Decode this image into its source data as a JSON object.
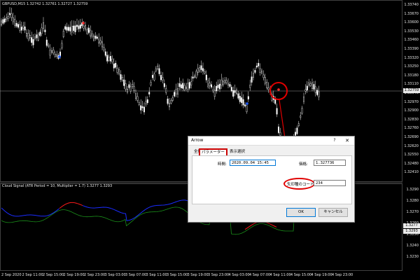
{
  "chart": {
    "title": "GBPUSD,M15  1.32742 1.32761 1.32727 1.32759",
    "current_price": "1.32759",
    "price_labels": [
      "1.33740",
      "1.33670",
      "1.33600",
      "1.33530",
      "1.33460",
      "1.33390",
      "1.33320",
      "1.33250",
      "1.33180",
      "1.33110",
      "1.33040",
      "1.32970",
      "1.32900",
      "1.32830",
      "1.32760",
      "1.32690",
      "1.32620",
      "1.32550",
      "1.32480",
      "1.32410"
    ],
    "time_labels": [
      "2 Sep 2020",
      "2 Sep 11:00",
      "2 Sep 15:00",
      "2 Sep 19:00",
      "2 Sep 23:00",
      "3 Sep 03:00",
      "3 Sep 07:00",
      "3 Sep 11:00",
      "3 Sep 15:00",
      "3 Sep 19:00",
      "3 Sep 23:00",
      "4 Sep 03:00",
      "4 Sep 07:00",
      "4 Sep 11:00",
      "4 Sep 15:00",
      "4 Sep 19:00",
      "4 Sep 23:00"
    ],
    "colors": {
      "background": "#000000",
      "candle": "#ffffff",
      "arrow_up": "#1e5bff",
      "arrow_down": "#ff2a2a",
      "annotation": "#e00000"
    }
  },
  "indicator": {
    "title": "Cloud Signal (ATR Period = 10, Multiplier = 1.7) 1.3277 1.3293",
    "price_labels": [
      "1.3290",
      "1.3280",
      "1.3270",
      "1.3260",
      "1.3250",
      "1.3240",
      "1.3230"
    ],
    "current_1": "1.3277",
    "current_2": "1.3293",
    "colors": {
      "line_blue": "#1a2cff",
      "line_red": "#ff1a1a",
      "line_green": "#1a8f1a"
    }
  },
  "dialog": {
    "title": "Arrow",
    "help": "?",
    "close": "✕",
    "tabs": [
      "全般",
      "パラメーター",
      "表示選択"
    ],
    "time_label": "時間:",
    "time_value": "2020.09.04 15:45",
    "price_label": "価格:",
    "price_value": "1.327736",
    "code_label": "矢印種のコード:",
    "code_value": "234",
    "ok": "OK",
    "cancel": "キャンセル"
  }
}
